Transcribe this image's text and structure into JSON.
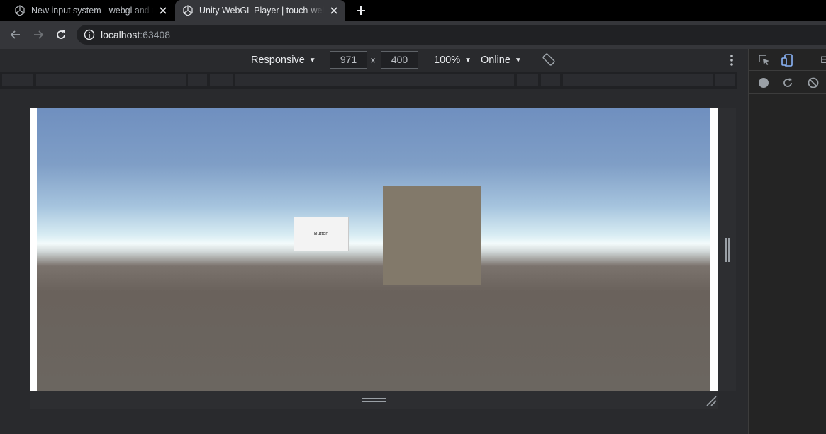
{
  "tabs": [
    {
      "title": "New input system - webgl and to",
      "icon": "unity-icon",
      "active": false
    },
    {
      "title": "Unity WebGL Player | touch-webg",
      "icon": "unity-icon",
      "active": true
    }
  ],
  "address": {
    "host": "localhost",
    "port": ":63408",
    "icon": "info-icon"
  },
  "device_toolbar": {
    "device": "Responsive",
    "width": "971",
    "height": "400",
    "times": "×",
    "zoom": "100%",
    "throttle": "Online",
    "caret": "▼"
  },
  "unity": {
    "button_label": "Button"
  },
  "devtools": {
    "tab_partial": "E",
    "icons": [
      "inspect-icon",
      "device-toggle-icon",
      "record-icon",
      "reload-icon",
      "clear-icon"
    ]
  },
  "colors": {
    "accent": "#8ab4f8",
    "tabstrip": "#000000",
    "toolbar": "#35363a",
    "cube": "#82796a"
  }
}
